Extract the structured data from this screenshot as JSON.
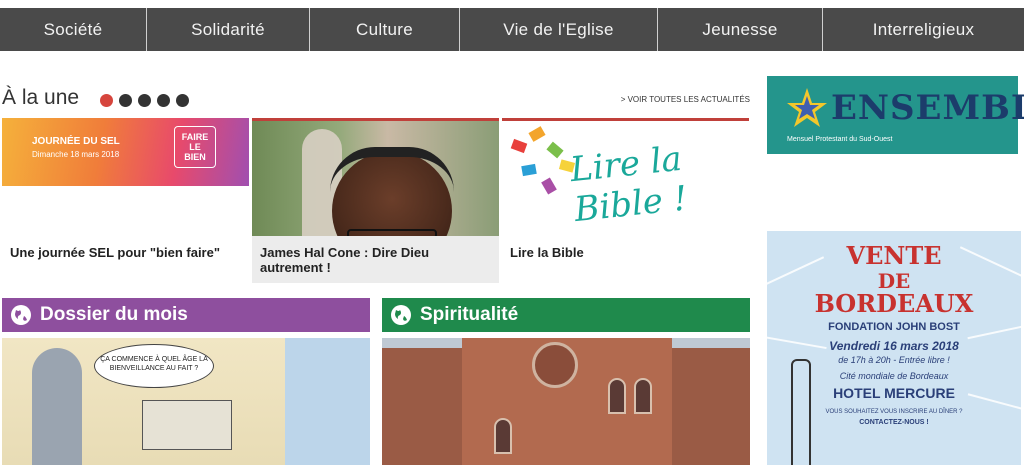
{
  "nav": {
    "items": [
      {
        "label": "Société"
      },
      {
        "label": "Solidarité"
      },
      {
        "label": "Culture"
      },
      {
        "label": "Vie de l'Eglise"
      },
      {
        "label": "Jeunesse"
      },
      {
        "label": "Interreligieux"
      }
    ]
  },
  "une": {
    "title": "À la une",
    "slides_total": 5,
    "active_slide": 1,
    "see_all": "> VOIR TOUTES LES ACTUALITÉS",
    "cards": [
      {
        "caption": "Une journée SEL pour \"bien faire\"",
        "thumb_title": "JOURNÉE DU SEL",
        "thumb_date": "Dimanche 18 mars 2018",
        "thumb_logo": "FAIRE LE BIEN"
      },
      {
        "caption": "James Hal Cone : Dire Dieu autrement !"
      },
      {
        "caption": "Lire la Bible",
        "thumb_text": "Lire la Bible !"
      }
    ]
  },
  "sections": {
    "dossier": {
      "title": "Dossier du mois",
      "bubble": "ÇA COMMENCE À QUEL ÂGE LA BIENVEILLANCE AU FAIT ?"
    },
    "spiritualite": {
      "title": "Spiritualité"
    }
  },
  "sidebar": {
    "ensemble": {
      "title": "ENSEMBLE",
      "subtitle": "Mensuel Protestant du Sud-Ouest"
    },
    "vente": {
      "line1": "VENTE",
      "line2": "DE",
      "line3": "BORDEAUX",
      "line4": "FONDATION JOHN BOST",
      "line5": "Vendredi 16 mars 2018",
      "line6": "de 17h à 20h - Entrée libre !",
      "line7": "Cité mondiale de Bordeaux",
      "line8": "HOTEL MERCURE",
      "line9": "VOUS SOUHAITEZ VOUS INSCRIRE AU DÎNER ?",
      "line10": "CONTACTEZ-NOUS !"
    }
  },
  "colors": {
    "nav_bg": "#4a4a4a",
    "accent_red": "#d6453d",
    "dossier_purple": "#8e4f9e",
    "spirit_green": "#1f8a4c",
    "ensemble_teal": "#24958c",
    "vente_red": "#c8322f"
  },
  "icons": {
    "section_icon": "globe-icon",
    "ensemble_logo": "star-logo-icon"
  }
}
